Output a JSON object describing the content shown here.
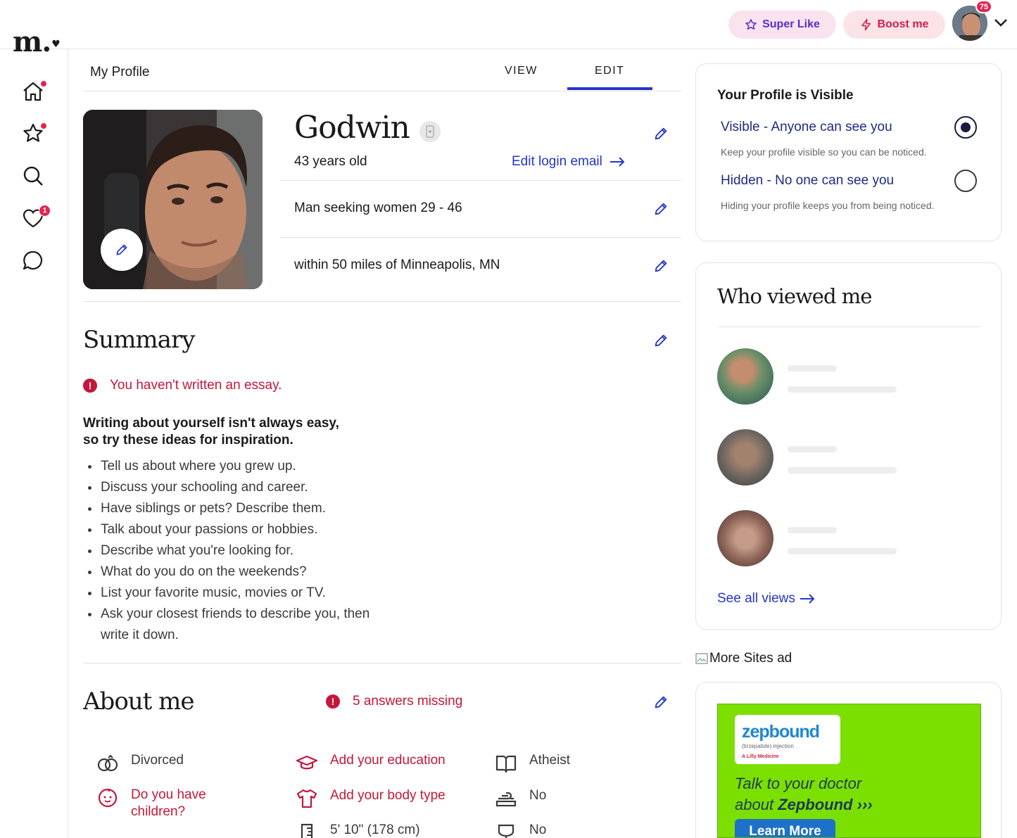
{
  "header": {
    "logo_text": "m.",
    "super_like_label": "Super Like",
    "boost_label": "Boost me",
    "notification_count": "75"
  },
  "sidebar": {
    "items": [
      {
        "icon": "home-icon",
        "has_dot": true
      },
      {
        "icon": "star-icon",
        "has_dot": true
      },
      {
        "icon": "search-icon",
        "has_dot": false
      },
      {
        "icon": "heart-icon",
        "badge": "1"
      },
      {
        "icon": "chat-icon",
        "has_dot": false
      }
    ]
  },
  "profile_tabs": {
    "title": "My Profile",
    "tabs": [
      "VIEW",
      "EDIT"
    ],
    "active_tab": "EDIT"
  },
  "profile": {
    "name": "Godwin",
    "age": "43 years old",
    "edit_login_email": "Edit login email",
    "seeking": "Man seeking women 29 - 46",
    "location": "within 50 miles of Minneapolis, MN"
  },
  "summary": {
    "title": "Summary",
    "alert": "You haven't written an essay.",
    "tips_heading_line1": "Writing about yourself isn't always easy,",
    "tips_heading_line2": "so try these ideas for inspiration.",
    "tips": [
      "Tell us about where you grew up.",
      "Discuss your schooling and career.",
      "Have siblings or pets? Describe them.",
      "Talk about your passions or hobbies.",
      "Describe what you're looking for.",
      "What do you do on the weekends?",
      "List your favorite music, movies or TV.",
      "Ask your closest friends to describe you, then write it down."
    ]
  },
  "about_me": {
    "title": "About me",
    "missing_alert": "5 answers missing",
    "attributes": [
      {
        "label": "Divorced",
        "icon": "rings-icon",
        "missing": false
      },
      {
        "label": "Add your education",
        "icon": "graduation-cap-icon",
        "missing": true
      },
      {
        "label": "Atheist",
        "icon": "book-icon",
        "missing": false
      },
      {
        "label": "Do you have children?",
        "icon": "baby-icon",
        "missing": true
      },
      {
        "label": "Add your body type",
        "icon": "shirt-icon",
        "missing": true
      },
      {
        "label": "No",
        "icon": "smoking-icon",
        "missing": false
      },
      {
        "label": "5' 10\" (178 cm)",
        "icon": "ruler-icon",
        "missing": false
      },
      {
        "label": "No",
        "icon": "drink-icon",
        "missing": false
      }
    ]
  },
  "visibility": {
    "title": "Your Profile is Visible",
    "options": [
      {
        "label": "Visible - Anyone can see you",
        "description": "Keep your profile visible so you can be noticed.",
        "selected": true
      },
      {
        "label": "Hidden - No one can see you",
        "description": "Hiding your profile keeps you from being noticed.",
        "selected": false
      }
    ]
  },
  "who_viewed": {
    "title": "Who viewed me",
    "see_all": "See all views"
  },
  "ad": {
    "alt_text": "More Sites ad",
    "brand": "zepbound",
    "brand_sub": "(tirzepatide) injection",
    "maker": "A Lilly Medicine",
    "line1": "Talk to your doctor",
    "line2_prefix": "about",
    "line2_brand": "Zepbound",
    "cta": "Learn More"
  },
  "colors": {
    "accent_blue": "#2336c9",
    "alert_red": "#c4173b",
    "badge_red": "#e0264f",
    "ad_green": "#7be000"
  }
}
